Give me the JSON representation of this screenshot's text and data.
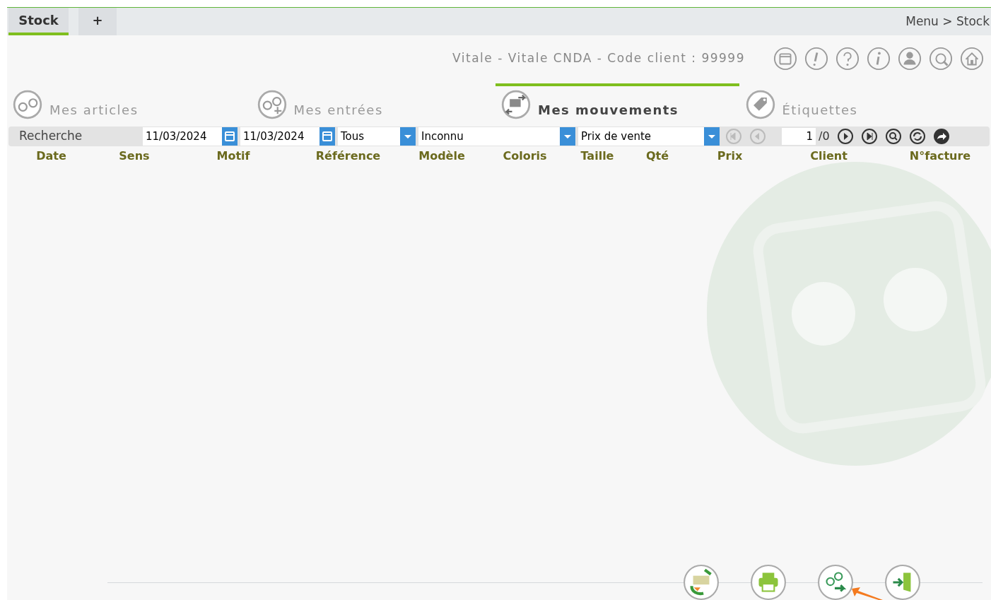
{
  "tabs": [
    {
      "label": "Stock",
      "selected": true
    },
    {
      "label": "+",
      "selected": false
    }
  ],
  "breadcrumb": "Menu > Stock",
  "client_info": "Vitale - Vitale CNDA - Code client : 99999",
  "sections": [
    {
      "label": "Mes articles",
      "kind": "glasses",
      "selected": false
    },
    {
      "label": "Mes entrées",
      "kind": "glasses-plus",
      "selected": false
    },
    {
      "label": "Mes mouvements",
      "kind": "movements",
      "selected": true
    },
    {
      "label": "Étiquettes",
      "kind": "tag",
      "selected": false
    }
  ],
  "search": {
    "label": "Recherche",
    "date_from": "11/03/2024",
    "date_to": "11/03/2024",
    "direction": "Tous",
    "reason": "Inconnu",
    "price_type": "Prix de vente",
    "page": "1",
    "page_total": "/0"
  },
  "columns": [
    "Date",
    "Sens",
    "Motif",
    "Référence",
    "Modèle",
    "Coloris",
    "Taille",
    "Qté",
    "Prix",
    "Client",
    "N°facture"
  ]
}
